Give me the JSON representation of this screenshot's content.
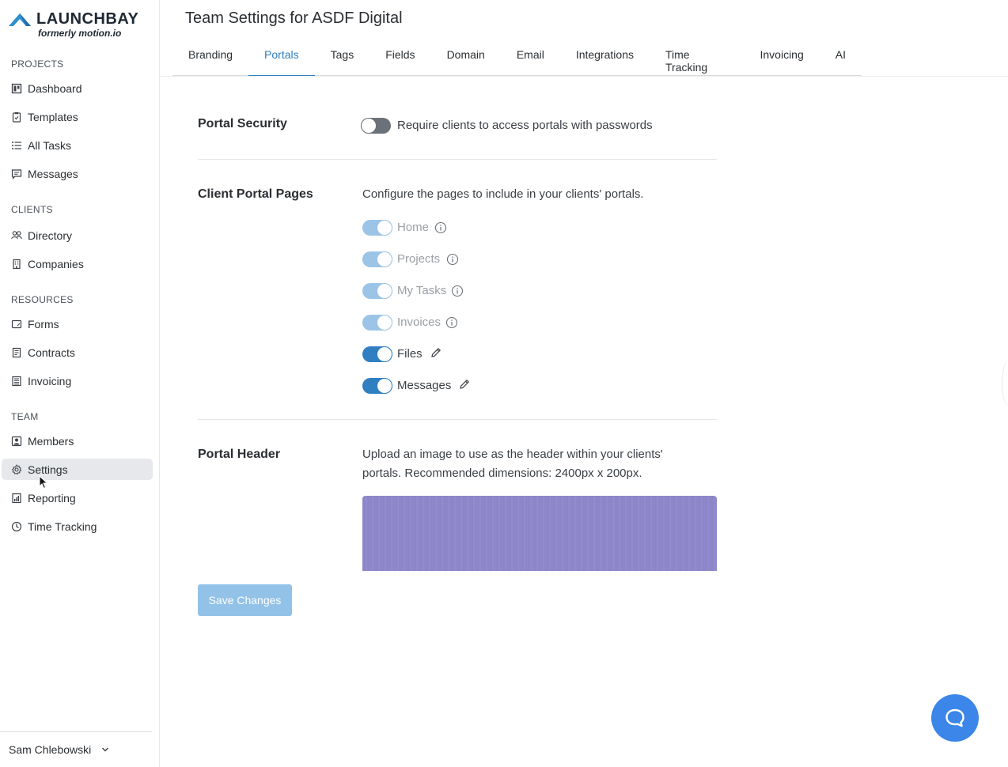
{
  "app": {
    "logo_text": "LAUNCHBAY",
    "logo_sub": "formerly motion.io",
    "brand_color": "#2f7fc1"
  },
  "sidebar": {
    "sections": [
      {
        "label": "PROJECTS",
        "items": [
          {
            "label": "Dashboard",
            "icon": "dashboard-icon"
          },
          {
            "label": "Templates",
            "icon": "template-icon"
          },
          {
            "label": "All Tasks",
            "icon": "list-icon"
          },
          {
            "label": "Messages",
            "icon": "message-icon"
          }
        ]
      },
      {
        "label": "CLIENTS",
        "items": [
          {
            "label": "Directory",
            "icon": "people-icon"
          },
          {
            "label": "Companies",
            "icon": "building-icon"
          }
        ]
      },
      {
        "label": "RESOURCES",
        "items": [
          {
            "label": "Forms",
            "icon": "form-icon"
          },
          {
            "label": "Contracts",
            "icon": "contract-icon"
          },
          {
            "label": "Invoicing",
            "icon": "invoice-icon"
          }
        ]
      },
      {
        "label": "TEAM",
        "items": [
          {
            "label": "Members",
            "icon": "member-icon"
          },
          {
            "label": "Settings",
            "icon": "gear-icon",
            "active": true
          },
          {
            "label": "Reporting",
            "icon": "report-icon"
          },
          {
            "label": "Time Tracking",
            "icon": "clock-icon"
          }
        ]
      }
    ],
    "user_name": "Sam Chlebowski"
  },
  "header": {
    "title": "Team Settings for ASDF Digital",
    "tabs": [
      "Branding",
      "Portals",
      "Tags",
      "Fields",
      "Domain",
      "Email",
      "Integrations",
      "Time Tracking",
      "Invoicing",
      "AI"
    ],
    "active_tab": "Portals"
  },
  "portal_security": {
    "title": "Portal Security",
    "toggle_label": "Require clients to access portals with passwords",
    "enabled": false
  },
  "client_portal_pages": {
    "title": "Client Portal Pages",
    "description": "Configure the pages to include in your clients' portals.",
    "pages": [
      {
        "label": "Home",
        "enabled": true,
        "locked": true,
        "icon": "info-icon"
      },
      {
        "label": "Projects",
        "enabled": true,
        "locked": true,
        "icon": "info-icon"
      },
      {
        "label": "My Tasks",
        "enabled": true,
        "locked": true,
        "icon": "info-icon"
      },
      {
        "label": "Invoices",
        "enabled": true,
        "locked": true,
        "icon": "info-icon"
      },
      {
        "label": "Files",
        "enabled": true,
        "locked": false,
        "icon": "pencil-icon"
      },
      {
        "label": "Messages",
        "enabled": true,
        "locked": false,
        "icon": "pencil-icon"
      }
    ]
  },
  "portal_header": {
    "title": "Portal Header",
    "description_line1": "Upload an image to use as the header within your clients'",
    "description_line2": "portals. Recommended dimensions: 2400px x 200px."
  },
  "actions": {
    "save_label": "Save Changes"
  }
}
